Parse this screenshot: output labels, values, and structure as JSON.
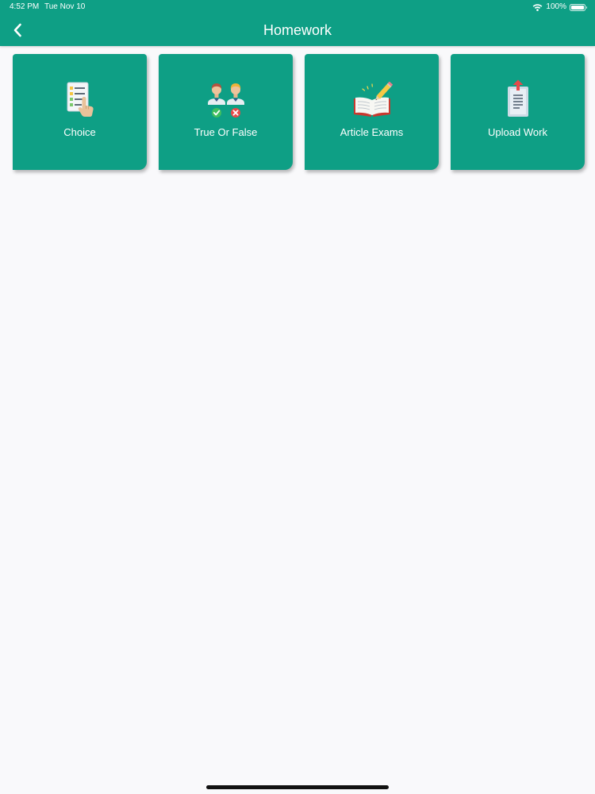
{
  "status_bar": {
    "time": "4:52 PM",
    "date": "Tue Nov 10",
    "battery_text": "100%",
    "battery_level": 1.0,
    "wifi_icon": "wifi-icon",
    "battery_icon": "battery-icon"
  },
  "header": {
    "title": "Homework",
    "back_icon": "chevron-left-icon",
    "background": "#0e9f85"
  },
  "cards": [
    {
      "label": "Choice",
      "icon": "checklist-tap-icon"
    },
    {
      "label": "True Or False",
      "icon": "true-false-people-icon"
    },
    {
      "label": "Article Exams",
      "icon": "open-book-pencil-icon"
    },
    {
      "label": "Upload Work",
      "icon": "document-upload-icon"
    }
  ],
  "colors": {
    "accent": "#0e9f85",
    "page_background": "#f9f9fb"
  }
}
